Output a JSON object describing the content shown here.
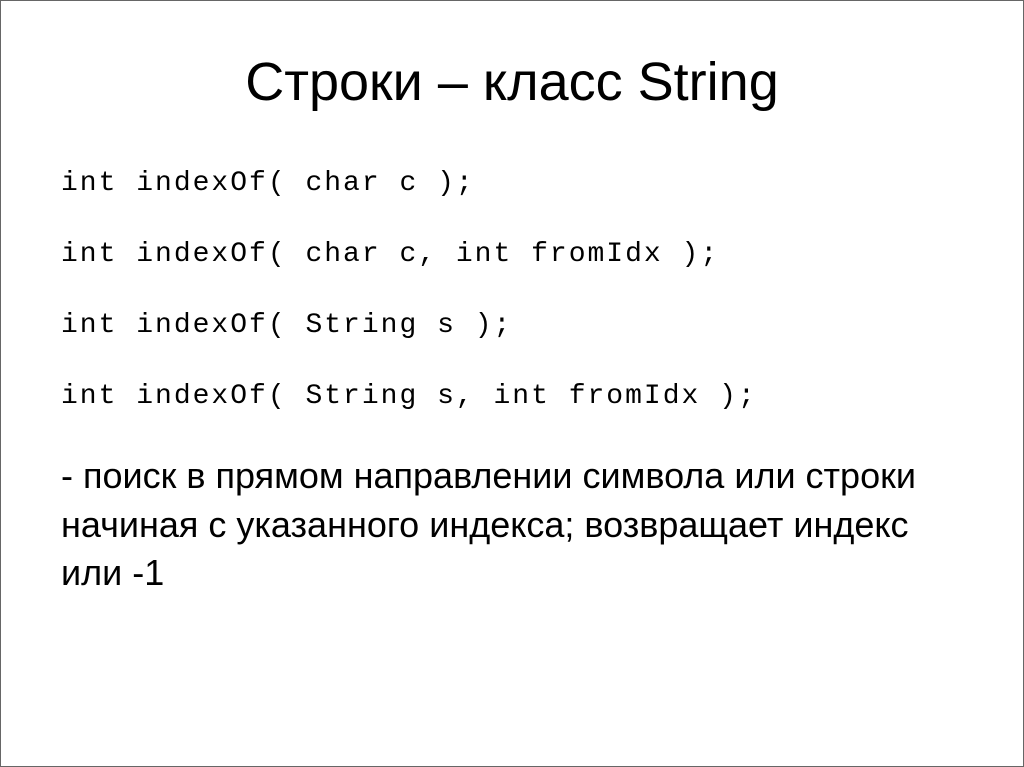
{
  "title": "Строки – класс String",
  "code": {
    "line1_prefix": "int index",
    "line1_of": "Of",
    "line1_rest": "( char c );",
    "line2_prefix": "int index",
    "line2_of": "Of",
    "line2_mid": "( char c, int from",
    "line2_idx": "Idx",
    "line2_end": " );",
    "line3_prefix": "int index",
    "line3_of": "Of",
    "line3_mid": "( ",
    "line3_str": "String",
    "line3_end": " s );",
    "line4_prefix": "int index",
    "line4_of": "Of",
    "line4_mid": "( ",
    "line4_str": "String",
    "line4_s": " s, int from",
    "line4_idx": "Idx",
    "line4_end": " );"
  },
  "description": "- поиск в прямом направлении символа или строки начиная с указанного индекса; возвращает индекс или -1"
}
